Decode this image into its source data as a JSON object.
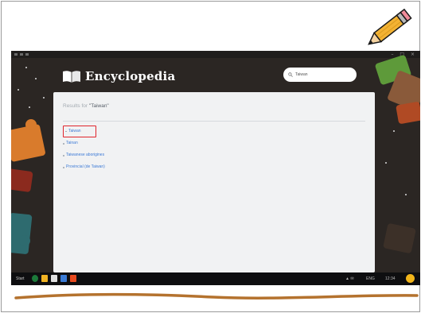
{
  "app": {
    "title": "Encyclopedia"
  },
  "search": {
    "value": "Taiwan"
  },
  "results": {
    "heading_prefix": "Results for",
    "heading_query": "\"Taiwan\"",
    "items": [
      {
        "label": "Taiwan"
      },
      {
        "label": "Tainan"
      },
      {
        "label": "Taiwanese aborigines"
      },
      {
        "label": "Provincial (de Taiwan)"
      }
    ]
  },
  "taskbar": {
    "start_label": "Start",
    "status_text": "ENG",
    "clock": "12:34"
  },
  "colors": {
    "accent_red": "#e0242c",
    "link_blue": "#3e7bd6",
    "background_dark": "#2b2623",
    "pencil_yellow": "#f3b233",
    "marker_brown": "#b4722e"
  }
}
